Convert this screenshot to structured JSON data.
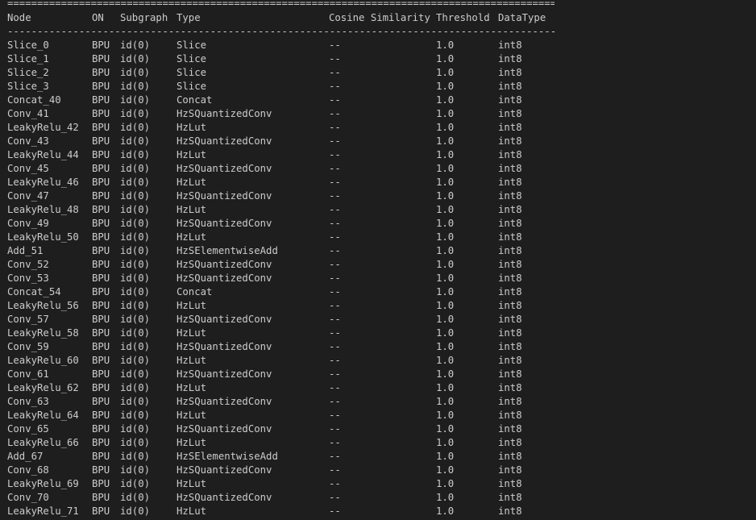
{
  "terminal": {
    "separator_top": "=============================================================================================================================",
    "separator_header": "-------------------------------------------------------------------------------------------------------------------------------",
    "headers": {
      "node": "Node",
      "on": "ON",
      "subgraph": "Subgraph",
      "type": "Type",
      "cosine": "Cosine Similarity",
      "threshold": "Threshold",
      "datatype": "DataType"
    },
    "rows": [
      {
        "node": "Slice_0",
        "on": "BPU",
        "subgraph": "id(0)",
        "type": "Slice",
        "cosine": "--",
        "threshold": "1.0",
        "datatype": "int8"
      },
      {
        "node": "Slice_1",
        "on": "BPU",
        "subgraph": "id(0)",
        "type": "Slice",
        "cosine": "--",
        "threshold": "1.0",
        "datatype": "int8"
      },
      {
        "node": "Slice_2",
        "on": "BPU",
        "subgraph": "id(0)",
        "type": "Slice",
        "cosine": "--",
        "threshold": "1.0",
        "datatype": "int8"
      },
      {
        "node": "Slice_3",
        "on": "BPU",
        "subgraph": "id(0)",
        "type": "Slice",
        "cosine": "--",
        "threshold": "1.0",
        "datatype": "int8"
      },
      {
        "node": "Concat_40",
        "on": "BPU",
        "subgraph": "id(0)",
        "type": "Concat",
        "cosine": "--",
        "threshold": "1.0",
        "datatype": "int8"
      },
      {
        "node": "Conv_41",
        "on": "BPU",
        "subgraph": "id(0)",
        "type": "HzSQuantizedConv",
        "cosine": "--",
        "threshold": "1.0",
        "datatype": "int8"
      },
      {
        "node": "LeakyRelu_42",
        "on": "BPU",
        "subgraph": "id(0)",
        "type": "HzLut",
        "cosine": "--",
        "threshold": "1.0",
        "datatype": "int8"
      },
      {
        "node": "Conv_43",
        "on": "BPU",
        "subgraph": "id(0)",
        "type": "HzSQuantizedConv",
        "cosine": "--",
        "threshold": "1.0",
        "datatype": "int8"
      },
      {
        "node": "LeakyRelu_44",
        "on": "BPU",
        "subgraph": "id(0)",
        "type": "HzLut",
        "cosine": "--",
        "threshold": "1.0",
        "datatype": "int8"
      },
      {
        "node": "Conv_45",
        "on": "BPU",
        "subgraph": "id(0)",
        "type": "HzSQuantizedConv",
        "cosine": "--",
        "threshold": "1.0",
        "datatype": "int8"
      },
      {
        "node": "LeakyRelu_46",
        "on": "BPU",
        "subgraph": "id(0)",
        "type": "HzLut",
        "cosine": "--",
        "threshold": "1.0",
        "datatype": "int8"
      },
      {
        "node": "Conv_47",
        "on": "BPU",
        "subgraph": "id(0)",
        "type": "HzSQuantizedConv",
        "cosine": "--",
        "threshold": "1.0",
        "datatype": "int8"
      },
      {
        "node": "LeakyRelu_48",
        "on": "BPU",
        "subgraph": "id(0)",
        "type": "HzLut",
        "cosine": "--",
        "threshold": "1.0",
        "datatype": "int8"
      },
      {
        "node": "Conv_49",
        "on": "BPU",
        "subgraph": "id(0)",
        "type": "HzSQuantizedConv",
        "cosine": "--",
        "threshold": "1.0",
        "datatype": "int8"
      },
      {
        "node": "LeakyRelu_50",
        "on": "BPU",
        "subgraph": "id(0)",
        "type": "HzLut",
        "cosine": "--",
        "threshold": "1.0",
        "datatype": "int8"
      },
      {
        "node": "Add_51",
        "on": "BPU",
        "subgraph": "id(0)",
        "type": "HzSElementwiseAdd",
        "cosine": "--",
        "threshold": "1.0",
        "datatype": "int8"
      },
      {
        "node": "Conv_52",
        "on": "BPU",
        "subgraph": "id(0)",
        "type": "HzSQuantizedConv",
        "cosine": "--",
        "threshold": "1.0",
        "datatype": "int8"
      },
      {
        "node": "Conv_53",
        "on": "BPU",
        "subgraph": "id(0)",
        "type": "HzSQuantizedConv",
        "cosine": "--",
        "threshold": "1.0",
        "datatype": "int8"
      },
      {
        "node": "Concat_54",
        "on": "BPU",
        "subgraph": "id(0)",
        "type": "Concat",
        "cosine": "--",
        "threshold": "1.0",
        "datatype": "int8"
      },
      {
        "node": "LeakyRelu_56",
        "on": "BPU",
        "subgraph": "id(0)",
        "type": "HzLut",
        "cosine": "--",
        "threshold": "1.0",
        "datatype": "int8"
      },
      {
        "node": "Conv_57",
        "on": "BPU",
        "subgraph": "id(0)",
        "type": "HzSQuantizedConv",
        "cosine": "--",
        "threshold": "1.0",
        "datatype": "int8"
      },
      {
        "node": "LeakyRelu_58",
        "on": "BPU",
        "subgraph": "id(0)",
        "type": "HzLut",
        "cosine": "--",
        "threshold": "1.0",
        "datatype": "int8"
      },
      {
        "node": "Conv_59",
        "on": "BPU",
        "subgraph": "id(0)",
        "type": "HzSQuantizedConv",
        "cosine": "--",
        "threshold": "1.0",
        "datatype": "int8"
      },
      {
        "node": "LeakyRelu_60",
        "on": "BPU",
        "subgraph": "id(0)",
        "type": "HzLut",
        "cosine": "--",
        "threshold": "1.0",
        "datatype": "int8"
      },
      {
        "node": "Conv_61",
        "on": "BPU",
        "subgraph": "id(0)",
        "type": "HzSQuantizedConv",
        "cosine": "--",
        "threshold": "1.0",
        "datatype": "int8"
      },
      {
        "node": "LeakyRelu_62",
        "on": "BPU",
        "subgraph": "id(0)",
        "type": "HzLut",
        "cosine": "--",
        "threshold": "1.0",
        "datatype": "int8"
      },
      {
        "node": "Conv_63",
        "on": "BPU",
        "subgraph": "id(0)",
        "type": "HzSQuantizedConv",
        "cosine": "--",
        "threshold": "1.0",
        "datatype": "int8"
      },
      {
        "node": "LeakyRelu_64",
        "on": "BPU",
        "subgraph": "id(0)",
        "type": "HzLut",
        "cosine": "--",
        "threshold": "1.0",
        "datatype": "int8"
      },
      {
        "node": "Conv_65",
        "on": "BPU",
        "subgraph": "id(0)",
        "type": "HzSQuantizedConv",
        "cosine": "--",
        "threshold": "1.0",
        "datatype": "int8"
      },
      {
        "node": "LeakyRelu_66",
        "on": "BPU",
        "subgraph": "id(0)",
        "type": "HzLut",
        "cosine": "--",
        "threshold": "1.0",
        "datatype": "int8"
      },
      {
        "node": "Add_67",
        "on": "BPU",
        "subgraph": "id(0)",
        "type": "HzSElementwiseAdd",
        "cosine": "--",
        "threshold": "1.0",
        "datatype": "int8"
      },
      {
        "node": "Conv_68",
        "on": "BPU",
        "subgraph": "id(0)",
        "type": "HzSQuantizedConv",
        "cosine": "--",
        "threshold": "1.0",
        "datatype": "int8"
      },
      {
        "node": "LeakyRelu_69",
        "on": "BPU",
        "subgraph": "id(0)",
        "type": "HzLut",
        "cosine": "--",
        "threshold": "1.0",
        "datatype": "int8"
      },
      {
        "node": "Conv_70",
        "on": "BPU",
        "subgraph": "id(0)",
        "type": "HzSQuantizedConv",
        "cosine": "--",
        "threshold": "1.0",
        "datatype": "int8"
      },
      {
        "node": "LeakyRelu_71",
        "on": "BPU",
        "subgraph": "id(0)",
        "type": "HzLut",
        "cosine": "--",
        "threshold": "1.0",
        "datatype": "int8"
      }
    ]
  }
}
